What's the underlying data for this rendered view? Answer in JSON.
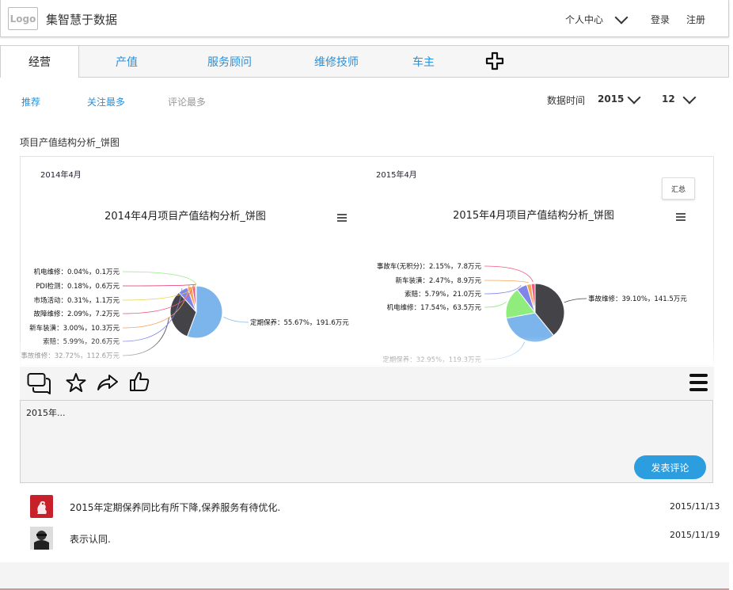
{
  "header": {
    "logo": "Logo",
    "title": "集智慧于数据",
    "user_center": "个人中心",
    "login": "登录",
    "register": "注册"
  },
  "tabs": [
    "经营",
    "产值",
    "服务顾问",
    "维修技师",
    "车主"
  ],
  "filters": {
    "recommend": "推荐",
    "most_followed": "关注最多",
    "most_commented": "评论最多",
    "date_label": "数据时间",
    "year": "2015",
    "month": "12"
  },
  "section_title": "项目产值结构分析_饼图",
  "summary_button": "汇总",
  "chart_data": [
    {
      "type": "pie",
      "period_label": "2014年4月",
      "title": "2014年4月项目产值结构分析_饼图",
      "slices": [
        {
          "label": "定期保养",
          "percent": 55.67,
          "value": 191.6,
          "unit": "万元",
          "text": "定期保养：55.67%，191.6万元",
          "color": "#7cb5ec"
        },
        {
          "label": "事故维修",
          "percent": 32.72,
          "value": 112.6,
          "unit": "万元",
          "text": "事故维修：32.72%，112.6万元",
          "color": "#434348"
        },
        {
          "label": "索赔",
          "percent": 5.99,
          "value": 20.6,
          "unit": "万元",
          "text": "索赔：5.99%，20.6万元",
          "color": "#8085e9"
        },
        {
          "label": "新车装潢",
          "percent": 3.0,
          "value": 10.3,
          "unit": "万元",
          "text": "新车装潢：3.00%，10.3万元",
          "color": "#f7a35c"
        },
        {
          "label": "故障维修",
          "percent": 2.09,
          "value": 7.2,
          "unit": "万元",
          "text": "故障维修：2.09%，7.2万元",
          "color": "#f15c80"
        },
        {
          "label": "市场活动",
          "percent": 0.31,
          "value": 1.1,
          "unit": "万元",
          "text": "市场活动：0.31%，1.1万元",
          "color": "#e4d354"
        },
        {
          "label": "PDI检测",
          "percent": 0.18,
          "value": 0.6,
          "unit": "万元",
          "text": "PDI检测：0.18%，0.6万元",
          "color": "#e0306e"
        },
        {
          "label": "机电维修",
          "percent": 0.04,
          "value": 0.1,
          "unit": "万元",
          "text": "机电维修：0.04%，0.1万元",
          "color": "#90ed7d"
        }
      ]
    },
    {
      "type": "pie",
      "period_label": "2015年4月",
      "title": "2015年4月项目产值结构分析_饼图",
      "slices": [
        {
          "label": "事故维修",
          "percent": 39.1,
          "value": 141.5,
          "unit": "万元",
          "text": "事故维修：39.10%，141.5万元",
          "color": "#434348"
        },
        {
          "label": "定期保养",
          "percent": 32.95,
          "value": 119.3,
          "unit": "万元",
          "text": "定期保养：32.95%，119.3万元",
          "color": "#7cb5ec"
        },
        {
          "label": "机电维修",
          "percent": 17.54,
          "value": 63.5,
          "unit": "万元",
          "text": "机电维修：17.54%，63.5万元",
          "color": "#90ed7d"
        },
        {
          "label": "索赔",
          "percent": 5.79,
          "value": 21.0,
          "unit": "万元",
          "text": "索赔：5.79%，21.0万元",
          "color": "#8085e9"
        },
        {
          "label": "新车装潢",
          "percent": 2.47,
          "value": 8.9,
          "unit": "万元",
          "text": "新车装潢：2.47%，8.9万元",
          "color": "#f7a35c"
        },
        {
          "label": "事故车(无积分)",
          "percent": 2.15,
          "value": 7.8,
          "unit": "万元",
          "text": "事故车(无积分)：2.15%，7.8万元",
          "color": "#f15c80"
        }
      ]
    }
  ],
  "comment_draft": "2015年...",
  "post_button": "发表评论",
  "comments": [
    {
      "text": "2015年定期保养同比有所下降,保养服务有待优化.",
      "date": "2015/11/13"
    },
    {
      "text": "表示认同.",
      "date": "2015/11/19"
    }
  ],
  "icons": {
    "action_bar": [
      "comment-icon",
      "star-icon",
      "share-icon",
      "thumbs-up-icon"
    ],
    "menu": "menu-icon",
    "add_tab": "plus-icon"
  }
}
